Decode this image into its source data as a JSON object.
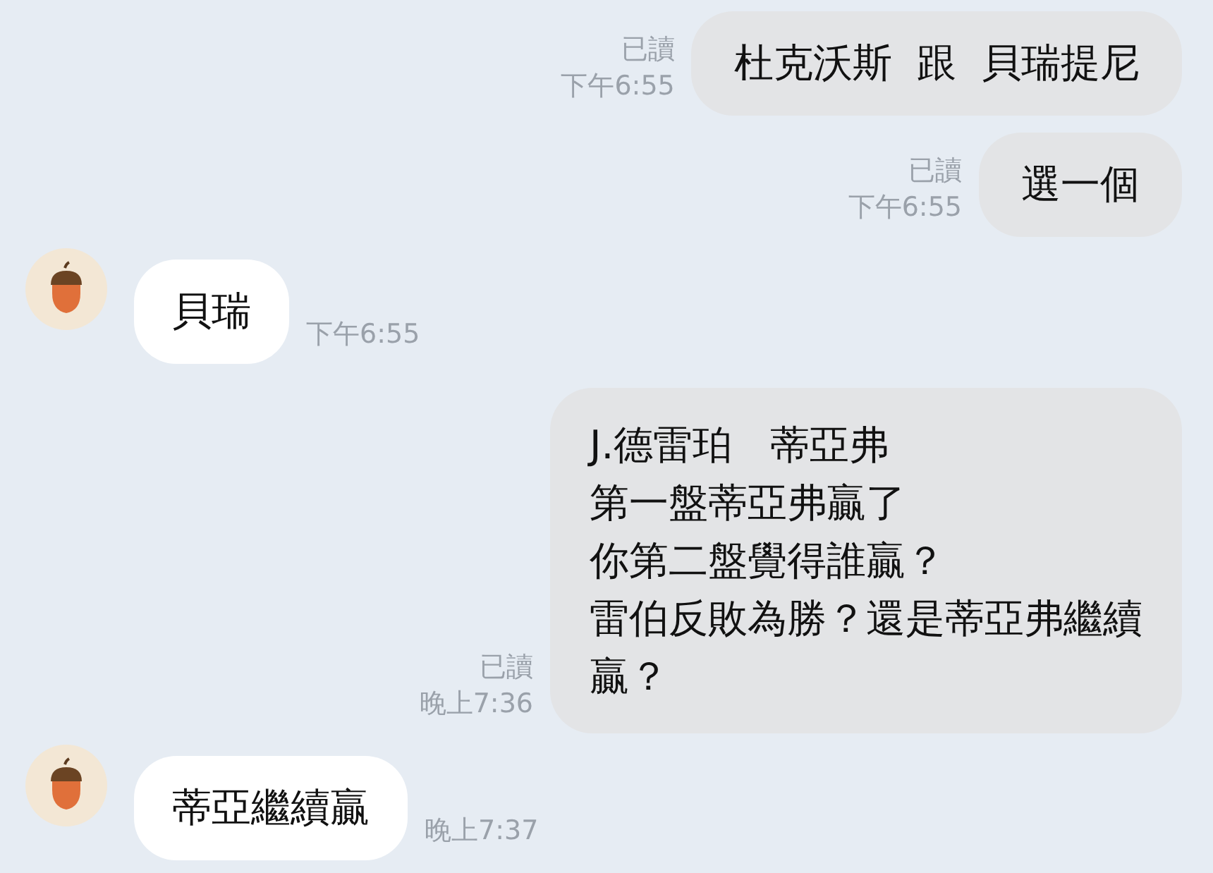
{
  "messages": [
    {
      "kind": "out",
      "lines": [
        "杜克沃斯  跟  貝瑞提尼"
      ],
      "read": "已讀",
      "time": "下午6:55"
    },
    {
      "kind": "out",
      "lines": [
        "選一個"
      ],
      "read": "已讀",
      "time": "下午6:55"
    },
    {
      "kind": "in",
      "lines": [
        "貝瑞"
      ],
      "time": "下午6:55"
    },
    {
      "kind": "out",
      "lines": [
        "J.德雷珀   蒂亞弗",
        "第一盤蒂亞弗贏了",
        "你第二盤覺得誰贏？",
        "雷伯反敗為勝？還是蒂亞弗繼續",
        "贏？"
      ],
      "read": "已讀",
      "time": "晚上7:36"
    },
    {
      "kind": "in",
      "lines": [
        "蒂亞繼續贏"
      ],
      "time": "晚上7:37"
    }
  ]
}
